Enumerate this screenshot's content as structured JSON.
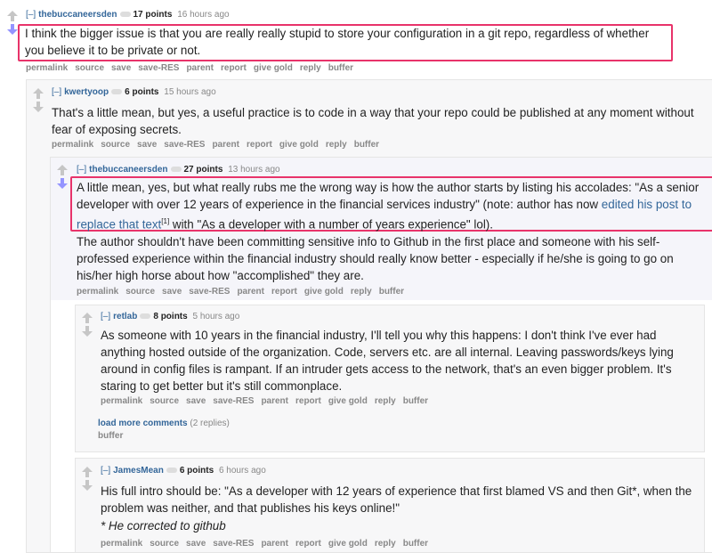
{
  "ui": {
    "expand": "[–]",
    "up_arrow": "up-arrow-icon",
    "down_arrow": "down-arrow-icon",
    "highlight_color": "#e8336a",
    "link_color": "#336699"
  },
  "comments": [
    {
      "author": "thebuccaneersden",
      "points": "17 points",
      "time": "16 hours ago",
      "text": "I think the bigger issue is that you are really really stupid to store your configuration in a git repo, regardless of whether you believe it to be private or not.",
      "buttons": [
        "permalink",
        "source",
        "save",
        "save-RES",
        "parent",
        "report",
        "give gold",
        "reply",
        "buffer"
      ]
    },
    {
      "author": "kwertyoop",
      "points": "6 points",
      "time": "15 hours ago",
      "text": "That's a little mean, but yes, a useful practice is to code in a way that your repo could be published at any moment without fear of exposing secrets.",
      "buttons": [
        "permalink",
        "source",
        "save",
        "save-RES",
        "parent",
        "report",
        "give gold",
        "reply",
        "buffer"
      ]
    },
    {
      "author": "thebuccaneersden",
      "points": "27 points",
      "time": "13 hours ago",
      "text_a": "A little mean, yes, but what really rubs me the wrong way is how the author starts by listing his accolades: \"As a senior developer with over 12 years of experience in the financial services industry\" (note: author has now ",
      "link": "edited his post to replace that text",
      "sup": "[1]",
      "text_b": " with \"As a developer with a number of years experience\" lol).",
      "text2": "The author shouldn't have been committing sensitive info to Github in the first place and someone with his self-professed experience within the financial industry should really know better - especially if he/she is going to go on his/her high horse about how \"accomplished\" they are.",
      "buttons": [
        "permalink",
        "source",
        "save",
        "save-RES",
        "parent",
        "report",
        "give gold",
        "reply",
        "buffer"
      ]
    },
    {
      "author": "retlab",
      "points": "8 points",
      "time": "5 hours ago",
      "text": "As someone with 10 years in the financial industry, I'll tell you why this happens: I don't think I've ever had anything hosted outside of the organization. Code, servers etc. are all internal. Leaving passwords/keys lying around in config files is rampant. If an intruder gets access to the network, that's an even bigger problem. It's staring to get better but it's still commonplace.",
      "buttons": [
        "permalink",
        "source",
        "save",
        "save-RES",
        "parent",
        "report",
        "give gold",
        "reply",
        "buffer"
      ],
      "load_more": "load more comments",
      "load_more_count": "(2 replies)",
      "load_more_buffer": "buffer"
    },
    {
      "author": "JamesMean",
      "points": "6 points",
      "time": "6 hours ago",
      "text": "His full intro should be: \"As a developer with 12 years of experience that first blamed VS and then Git*, when the problem was neither, and that publishes his keys online!\"",
      "note": "* He corrected to github",
      "buttons": [
        "permalink",
        "source",
        "save",
        "save-RES",
        "parent",
        "report",
        "give gold",
        "reply",
        "buffer"
      ]
    }
  ]
}
